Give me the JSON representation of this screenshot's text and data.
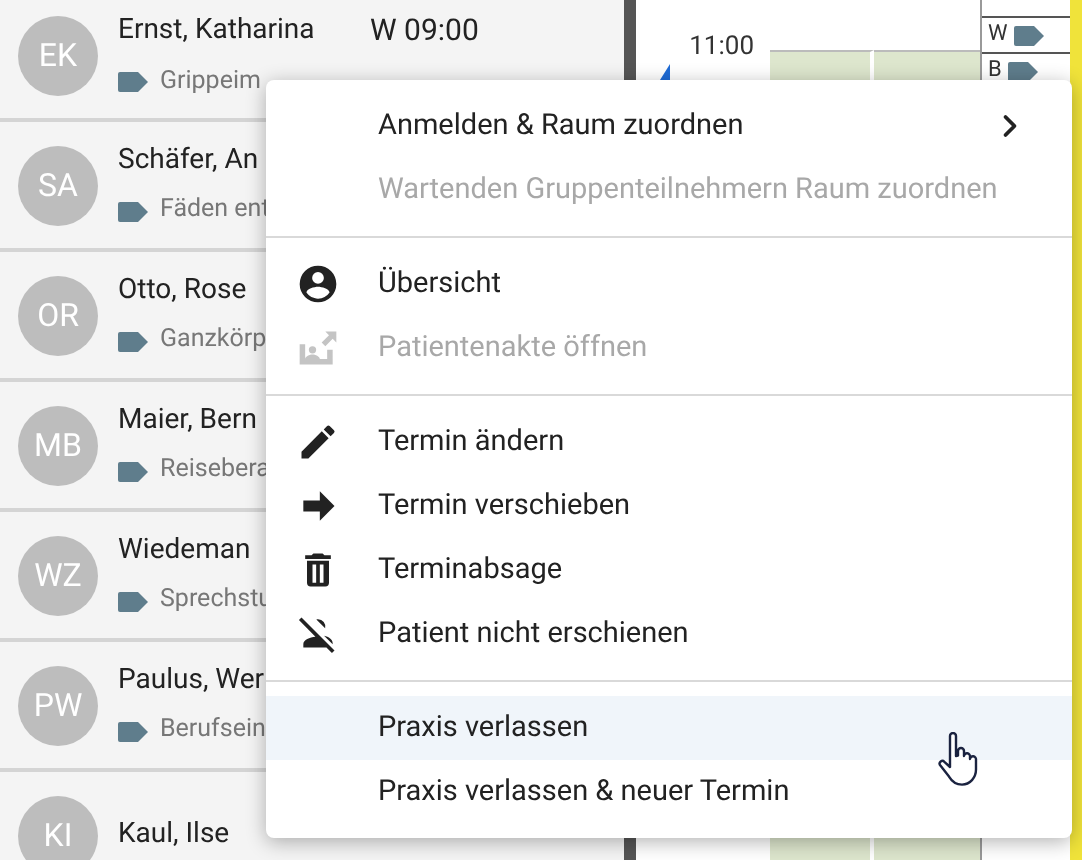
{
  "patients": [
    {
      "initials": "EK",
      "name": "Ernst, Katharina",
      "time": "W 09:00",
      "tag": "Grippeim"
    },
    {
      "initials": "SA",
      "name": "Schäfer, An",
      "tag": "Fäden ent"
    },
    {
      "initials": "OR",
      "name": "Otto, Rose",
      "tag": "Ganzkörp"
    },
    {
      "initials": "MB",
      "name": "Maier, Bern",
      "tag": "Reisebera"
    },
    {
      "initials": "WZ",
      "name": "Wiedeman",
      "tag": "Sprechstu"
    },
    {
      "initials": "PW",
      "name": "Paulus, Wer",
      "tag": "Berufsein"
    },
    {
      "initials": "KI",
      "name": "Kaul, Ilse"
    }
  ],
  "calendar": {
    "time": "11:00",
    "side_rows": [
      {
        "letter": "W"
      },
      {
        "letter": "B"
      }
    ]
  },
  "context_menu": {
    "groups": [
      {
        "items": [
          {
            "label": "Anmelden & Raum zuordnen",
            "disabled": false,
            "highlighted": false,
            "submenu": true
          },
          {
            "label": "Wartenden Gruppenteilnehmern Raum zuordnen",
            "disabled": true,
            "highlighted": false,
            "submenu": false
          }
        ]
      },
      {
        "items": [
          {
            "label": "Übersicht",
            "disabled": false,
            "highlighted": false,
            "submenu": false
          },
          {
            "label": "Patientenakte öffnen",
            "disabled": true,
            "highlighted": false,
            "submenu": false
          }
        ]
      },
      {
        "items": [
          {
            "label": "Termin ändern",
            "disabled": false,
            "highlighted": false,
            "submenu": false
          },
          {
            "label": "Termin verschieben",
            "disabled": false,
            "highlighted": false,
            "submenu": false
          },
          {
            "label": "Terminabsage",
            "disabled": false,
            "highlighted": false,
            "submenu": false
          },
          {
            "label": "Patient nicht erschienen",
            "disabled": false,
            "highlighted": false,
            "submenu": false
          }
        ]
      },
      {
        "items": [
          {
            "label": "Praxis verlassen",
            "disabled": false,
            "highlighted": true,
            "submenu": false
          },
          {
            "label": "Praxis verlassen & neuer Termin",
            "disabled": false,
            "highlighted": false,
            "submenu": false
          }
        ]
      }
    ]
  }
}
